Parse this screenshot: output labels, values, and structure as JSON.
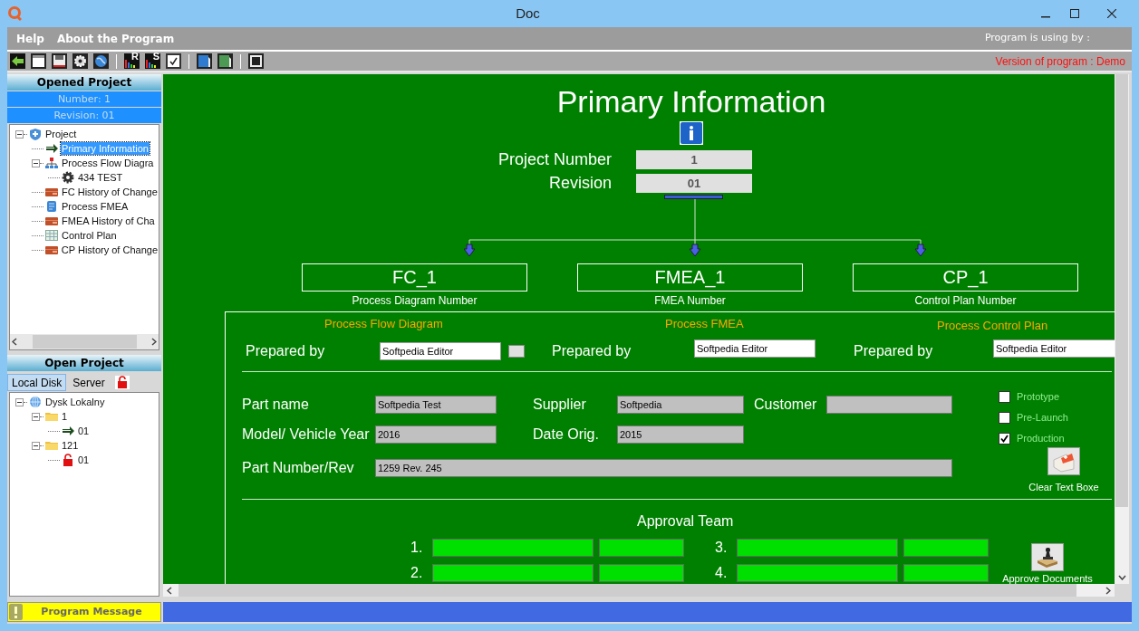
{
  "window": {
    "title": "Doc"
  },
  "menu": [
    {
      "label": "Help"
    },
    {
      "label": "About the Program"
    }
  ],
  "user_info": "Program is using by :",
  "toolbar": [
    {
      "kind": "back"
    },
    {
      "kind": "window"
    },
    {
      "kind": "save"
    },
    {
      "kind": "gear"
    },
    {
      "kind": "globe"
    },
    {
      "kind": "separator"
    },
    {
      "kind": "chart",
      "letter": "R"
    },
    {
      "kind": "chart",
      "letter": "S"
    },
    {
      "kind": "checklist"
    },
    {
      "kind": "separator"
    },
    {
      "kind": "page"
    },
    {
      "kind": "sheet"
    },
    {
      "kind": "separator"
    },
    {
      "kind": "frame"
    }
  ],
  "version": "Version of program : Demo",
  "opened_project": {
    "title": "Opened Project",
    "number": "Number: 1",
    "revision": "Revision: 01",
    "tree": [
      {
        "label": "Project",
        "kind": "shield",
        "selected": false,
        "expanded": true,
        "children": [
          {
            "label": "Primary Information",
            "kind": "arrow",
            "selected": true
          },
          {
            "label": "Process Flow Diagra",
            "kind": "flowchart",
            "selected": false,
            "expanded": true,
            "children": [
              {
                "label": "434 TEST",
                "kind": "gear",
                "selected": false
              }
            ]
          },
          {
            "label": "FC History of Change",
            "kind": "history",
            "selected": false
          },
          {
            "label": "Process FMEA",
            "kind": "scroll",
            "selected": false
          },
          {
            "label": "FMEA History of Cha",
            "kind": "history",
            "selected": false
          },
          {
            "label": "Control Plan",
            "kind": "table",
            "selected": false
          },
          {
            "label": "CP History of Change",
            "kind": "history",
            "selected": false
          }
        ]
      }
    ]
  },
  "open_project": {
    "title": "Open Project",
    "tabs": [
      {
        "label": "Local Disk",
        "selected": true
      },
      {
        "label": "Server",
        "selected": false
      }
    ],
    "tree": [
      {
        "label": "Dysk Lokalny",
        "kind": "globe",
        "selected": false,
        "expanded": true,
        "children": [
          {
            "label": "1",
            "kind": "folder",
            "selected": false,
            "expanded": true,
            "children": [
              {
                "label": "01",
                "kind": "arrow",
                "selected": false
              }
            ]
          },
          {
            "label": "121",
            "kind": "folder",
            "selected": false,
            "expanded": true,
            "children": [
              {
                "label": "01",
                "kind": "lock",
                "selected": false
              }
            ]
          }
        ]
      }
    ]
  },
  "main": {
    "title": "Primary Information",
    "project_number": {
      "label": "Project Number",
      "value": "1"
    },
    "revision": {
      "label": "Revision",
      "value": "01"
    },
    "documents": [
      {
        "number": "FC_1",
        "caption": "Process Diagram Number"
      },
      {
        "number": "FMEA_1",
        "caption": "FMEA Number"
      },
      {
        "number": "CP_1",
        "caption": "Control Plan Number"
      }
    ],
    "sections": [
      {
        "heading": "Process Flow Diagram",
        "prepared_label": "Prepared by",
        "prepared_value": "Softpedia Editor"
      },
      {
        "heading": "Process FMEA",
        "prepared_label": "Prepared by",
        "prepared_value": "Softpedia Editor"
      },
      {
        "heading": "Process Control Plan",
        "prepared_label": "Prepared by",
        "prepared_value": "Softpedia Editor"
      }
    ],
    "part_name": {
      "label": "Part name",
      "value": "Softpedia Test"
    },
    "supplier": {
      "label": "Supplier",
      "value": "Softpedia"
    },
    "customer": {
      "label": "Customer"
    },
    "model_year": {
      "label": "Model/ Vehicle Year",
      "value": "2016"
    },
    "date_orig": {
      "label": "Date Orig.",
      "value": "2015"
    },
    "part_number": {
      "label": "Part Number/Rev",
      "value": "1259 Rev. 245"
    },
    "phases": [
      {
        "label": "Prototype",
        "checked": false
      },
      {
        "label": "Pre-Launch",
        "checked": false
      },
      {
        "label": "Production",
        "checked": true
      }
    ],
    "clear_button": "Clear Text Boxe",
    "approval_team": {
      "title": "Approval Team",
      "members": [
        {
          "number": "1."
        },
        {
          "number": "2."
        },
        {
          "number": "3."
        },
        {
          "number": "4."
        }
      ]
    },
    "approve_button": "Approve Documents"
  },
  "status_bar": {
    "message_label": "Program Message"
  }
}
